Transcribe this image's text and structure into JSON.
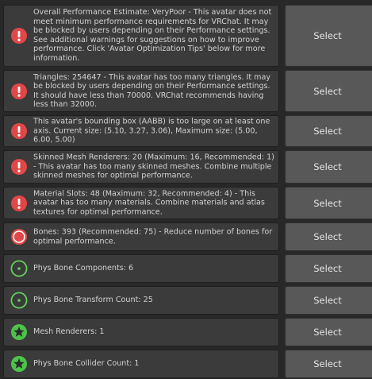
{
  "colors": {
    "error": "#e04848",
    "info": "#5fd35a",
    "good": "#4cc44a"
  },
  "rows": [
    {
      "severity": "error",
      "icon": "exclamation-circle-icon",
      "message": "Overall Performance Estimate: VeryPoor - This avatar does not meet minimum performance requirements for VRChat. It may be blocked by users depending on their Performance settings. See additional warnings for suggestions on how to improve performance. Click 'Avatar Optimization Tips' below for more information.",
      "button": "Select"
    },
    {
      "severity": "error",
      "icon": "exclamation-circle-icon",
      "message": "Triangles: 254647 - This avatar has too many triangles. It may be blocked by users depending on their Performance settings. It should have less than 70000. VRChat recommends having less than 32000.",
      "button": "Select"
    },
    {
      "severity": "error",
      "icon": "exclamation-circle-icon",
      "message": "This avatar's bounding box (AABB) is too large on at least one axis. Current size: (5.10, 3.27, 3.06), Maximum size: (5.00, 6.00, 5.00)",
      "button": "Select"
    },
    {
      "severity": "error",
      "icon": "exclamation-circle-icon",
      "message": "Skinned Mesh Renderers: 20 (Maximum: 16, Recommended: 1) - This avatar has too many skinned meshes. Combine multiple skinned meshes for optimal performance.",
      "button": "Select"
    },
    {
      "severity": "error",
      "icon": "exclamation-circle-icon",
      "message": "Material Slots: 48 (Maximum: 32, Recommended: 4) - This avatar has too many materials. Combine materials and atlas textures for optimal performance.",
      "button": "Select"
    },
    {
      "severity": "error",
      "icon": "filled-circle-icon",
      "message": "Bones: 393 (Recommended: 75) - Reduce number of bones for optimal performance.",
      "button": "Select"
    },
    {
      "severity": "info",
      "icon": "dot-circle-icon",
      "message": "Phys Bone Components: 6",
      "button": "Select"
    },
    {
      "severity": "info",
      "icon": "dot-circle-icon",
      "message": "Phys Bone Transform Count: 25",
      "button": "Select"
    },
    {
      "severity": "good",
      "icon": "star-circle-icon",
      "message": "Mesh Renderers: 1",
      "button": "Select"
    },
    {
      "severity": "good",
      "icon": "star-circle-icon",
      "message": "Phys Bone Collider Count: 1",
      "button": "Select"
    }
  ]
}
